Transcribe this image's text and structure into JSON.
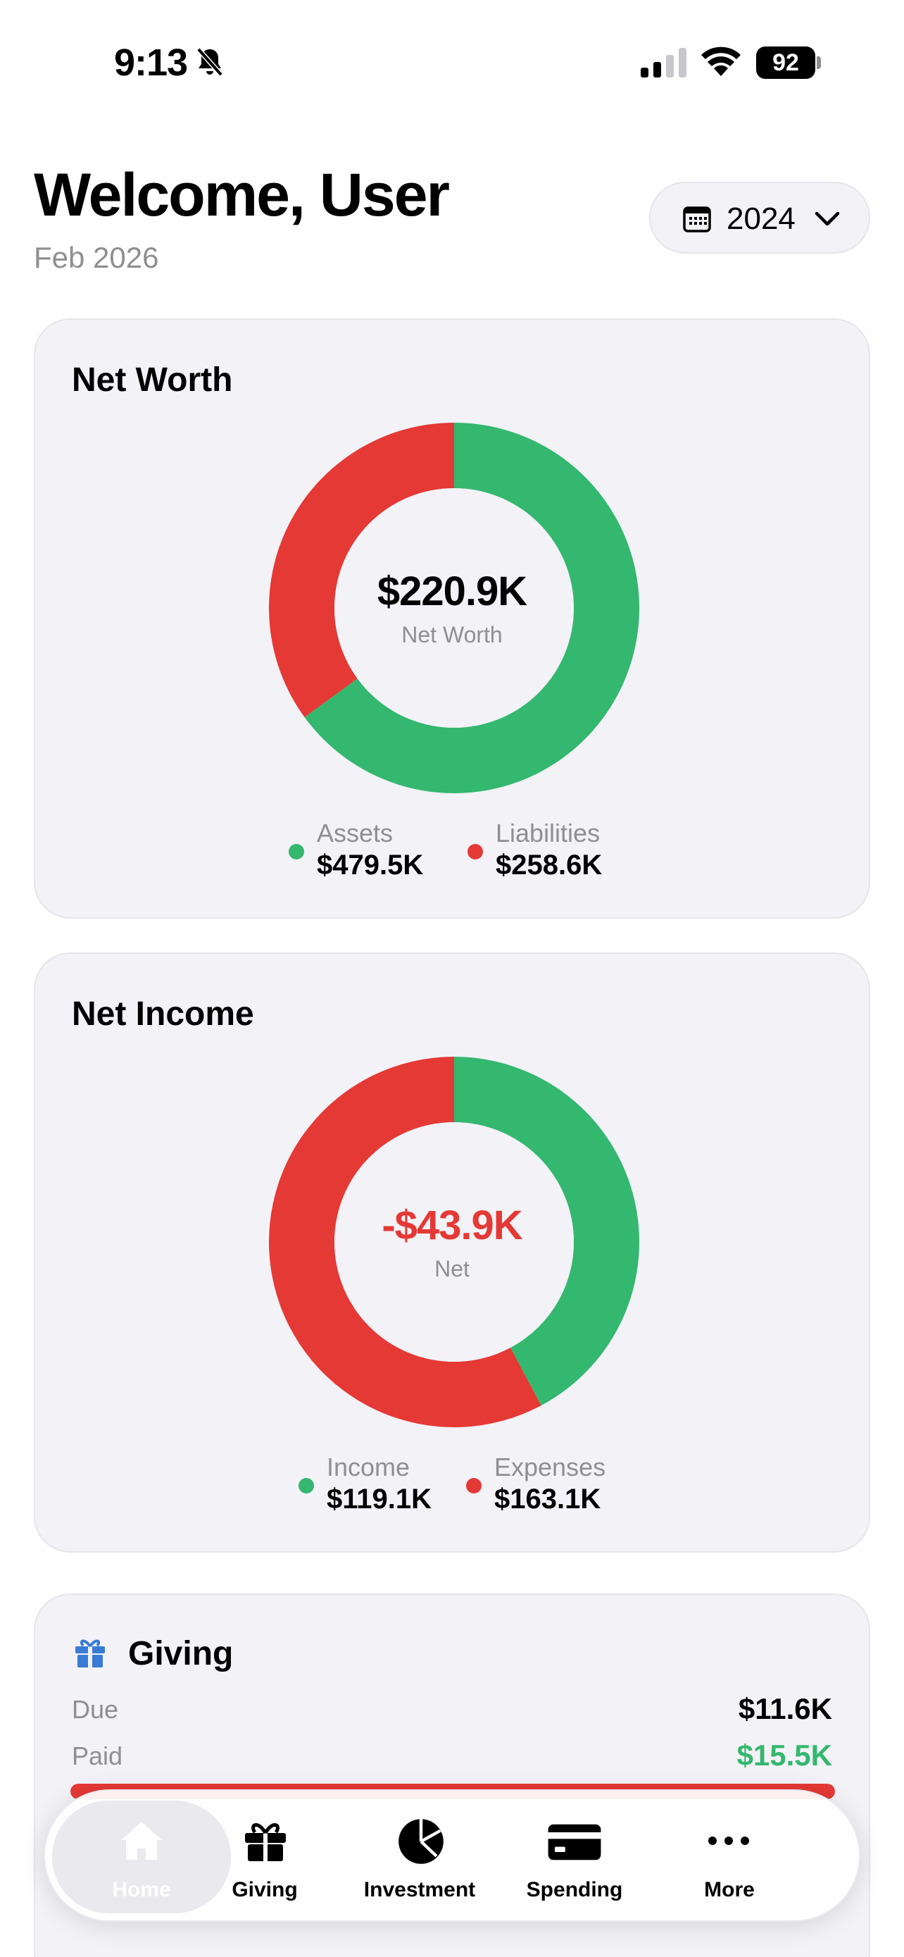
{
  "status_bar": {
    "time": "9:13",
    "battery": "92"
  },
  "header": {
    "title": "Welcome, User",
    "date": "Feb 2026",
    "year": "2024"
  },
  "net_worth": {
    "title": "Net Worth",
    "center_value": "$220.9K",
    "center_label": "Net Worth",
    "legend": [
      {
        "name": "Assets",
        "value": "$479.5K",
        "color": "#34b76f"
      },
      {
        "name": "Liabilities",
        "value": "$258.6K",
        "color": "#e53935"
      }
    ],
    "chart_data": {
      "type": "pie",
      "categories": [
        "Assets",
        "Liabilities"
      ],
      "values": [
        479.5,
        258.6
      ],
      "colors": [
        "#34b76f",
        "#e53935"
      ]
    }
  },
  "net_income": {
    "title": "Net Income",
    "center_value": "-$43.9K",
    "center_label": "Net",
    "center_color": "#e53935",
    "legend": [
      {
        "name": "Income",
        "value": "$119.1K",
        "color": "#34b76f"
      },
      {
        "name": "Expenses",
        "value": "$163.1K",
        "color": "#e53935"
      }
    ],
    "chart_data": {
      "type": "pie",
      "categories": [
        "Income",
        "Expenses"
      ],
      "values": [
        119.1,
        163.1
      ],
      "colors": [
        "#34b76f",
        "#e53935"
      ]
    }
  },
  "giving": {
    "title": "Giving",
    "due_label": "Due",
    "due_value": "$11.6K",
    "paid_label": "Paid",
    "paid_value": "$15.5K",
    "paid_color": "#34b76f",
    "progress_fraction": 1.0,
    "progress_color": "#e53935"
  },
  "tabbar": {
    "active": "Home",
    "tabs": [
      {
        "label": "Home",
        "icon": "home-icon"
      },
      {
        "label": "Giving",
        "icon": "gift-icon"
      },
      {
        "label": "Investment",
        "icon": "pie-chart-icon"
      },
      {
        "label": "Spending",
        "icon": "credit-card-icon"
      },
      {
        "label": "More",
        "icon": "more-icon"
      }
    ]
  },
  "colors": {
    "accent": "#3a7bd5",
    "green": "#34b76f",
    "red": "#e53935",
    "card_bg": "#f2f2f7"
  }
}
